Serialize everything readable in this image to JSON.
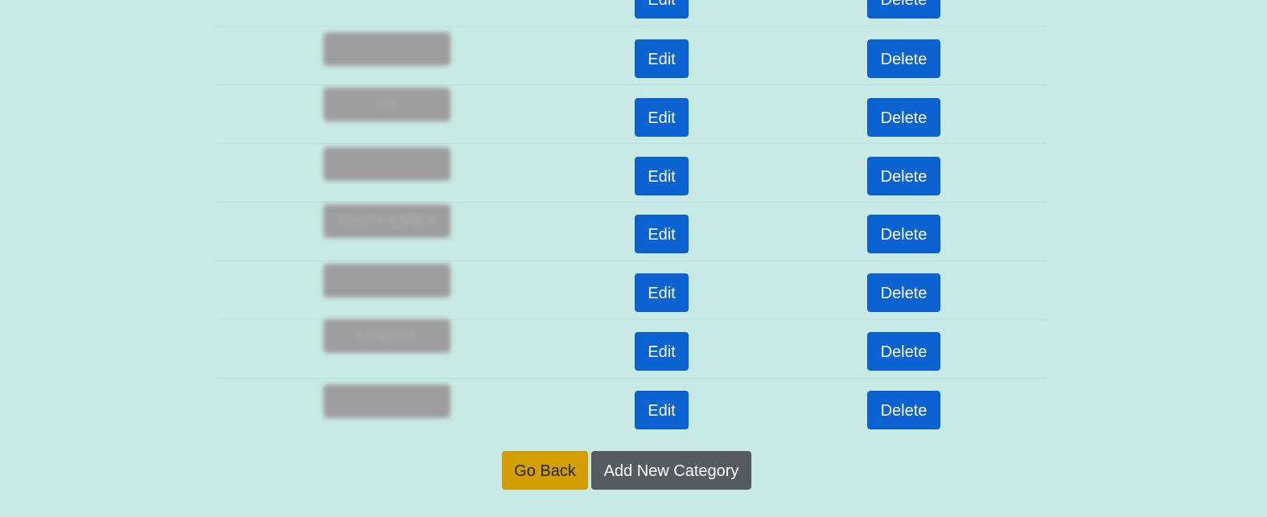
{
  "table": {
    "rows": [
      {
        "name": "",
        "edit_label": "Edit",
        "delete_label": "Delete"
      },
      {
        "name": "",
        "edit_label": "Edit",
        "delete_label": "Delete"
      },
      {
        "name": "UK",
        "edit_label": "Edit",
        "delete_label": "Delete"
      },
      {
        "name": "",
        "edit_label": "Edit",
        "delete_label": "Delete"
      },
      {
        "name": "SOUTH KOREA",
        "edit_label": "Edit",
        "delete_label": "Delete"
      },
      {
        "name": "",
        "edit_label": "Edit",
        "delete_label": "Delete"
      },
      {
        "name": "LONDON",
        "edit_label": "Edit",
        "delete_label": "Delete"
      },
      {
        "name": "",
        "edit_label": "Edit",
        "delete_label": "Delete"
      }
    ]
  },
  "actions": {
    "go_back_label": "Go Back",
    "add_category_label": "Add New Category"
  },
  "colors": {
    "background": "#c8eae6",
    "primary_button": "#0a63d0",
    "warning_button": "#d39e00",
    "secondary_button": "#545b62"
  }
}
